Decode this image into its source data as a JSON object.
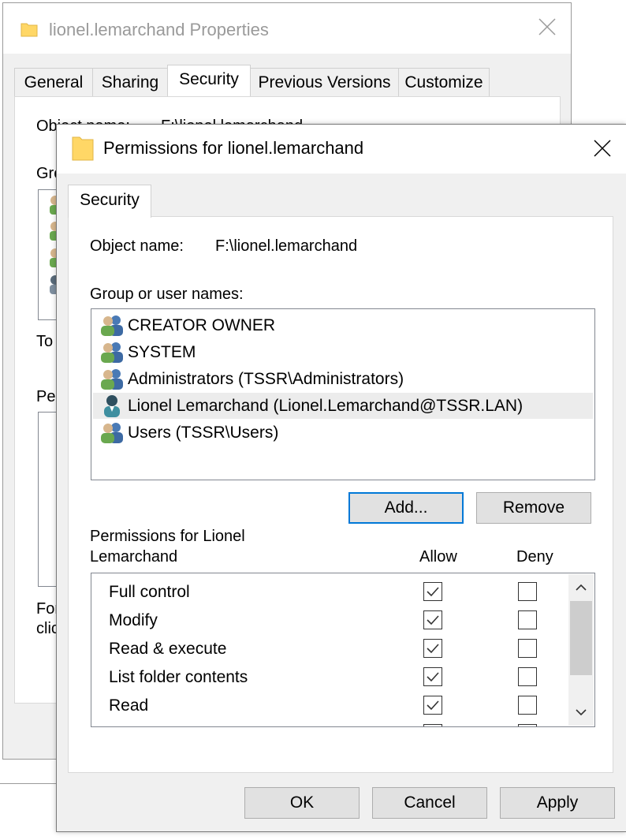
{
  "background_window": {
    "title": "lionel.lemarchand Properties",
    "tabs": [
      "General",
      "Sharing",
      "Security",
      "Previous Versions",
      "Customize"
    ],
    "active_tab": "Security",
    "fragments": [
      "Object name:",
      "F:\\lionel.lemarchand",
      "Gro",
      "To",
      "Pe",
      "For",
      "clic"
    ]
  },
  "dialog": {
    "title": "Permissions for lionel.lemarchand",
    "tab": "Security",
    "object_label": "Object name:",
    "object_value": "F:\\lionel.lemarchand",
    "group_label": "Group or user names:",
    "users": [
      {
        "name": "CREATOR OWNER",
        "icon": "group-icon",
        "selected": false
      },
      {
        "name": "SYSTEM",
        "icon": "group-icon",
        "selected": false
      },
      {
        "name": "Administrators (TSSR\\Administrators)",
        "icon": "group-icon",
        "selected": false
      },
      {
        "name": "Lionel Lemarchand (Lionel.Lemarchand@TSSR.LAN)",
        "icon": "user-icon",
        "selected": true
      },
      {
        "name": "Users (TSSR\\Users)",
        "icon": "group-icon",
        "selected": false
      }
    ],
    "add_button": "Add...",
    "remove_button": "Remove",
    "perm_label_line1": "Permissions for Lionel",
    "perm_label_line2": "Lemarchand",
    "allow_header": "Allow",
    "deny_header": "Deny",
    "permissions": [
      {
        "name": "Full control",
        "allow": true,
        "deny": false
      },
      {
        "name": "Modify",
        "allow": true,
        "deny": false
      },
      {
        "name": "Read & execute",
        "allow": true,
        "deny": false
      },
      {
        "name": "List folder contents",
        "allow": true,
        "deny": false
      },
      {
        "name": "Read",
        "allow": true,
        "deny": false
      }
    ],
    "ok_button": "OK",
    "cancel_button": "Cancel",
    "apply_button": "Apply"
  },
  "colors": {
    "accent": "#0078d7",
    "folder": "#ffd766",
    "selected_row": "#ececec",
    "window_bg": "#f0f0f0"
  }
}
